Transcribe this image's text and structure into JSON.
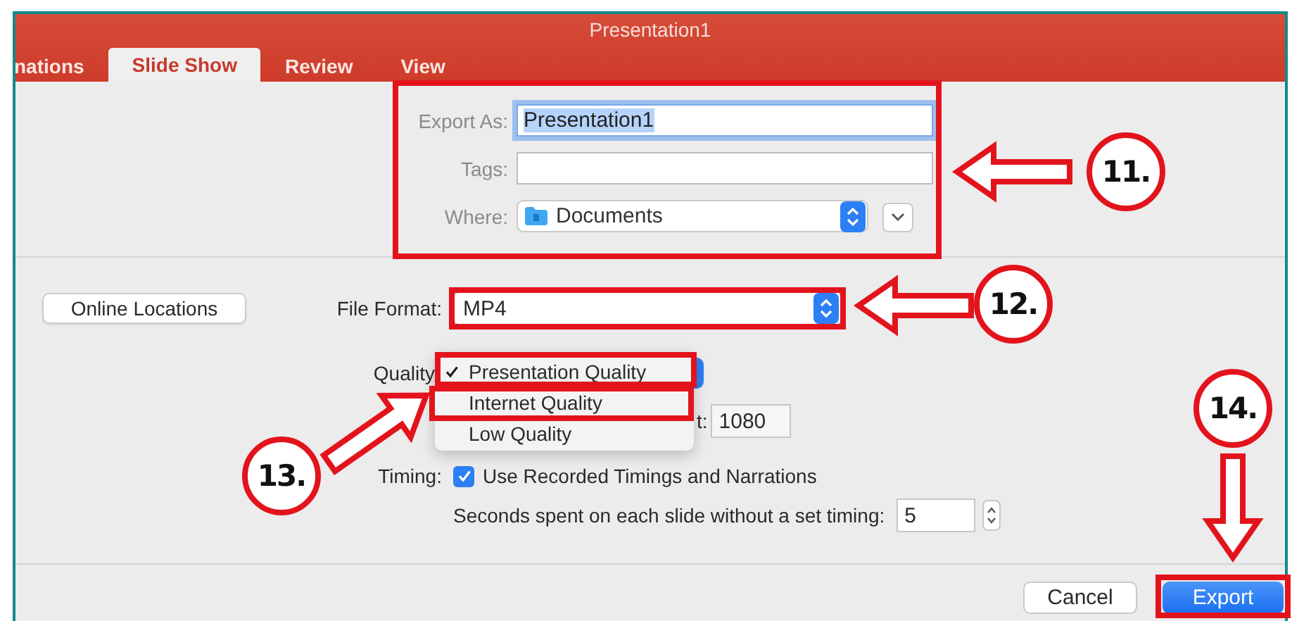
{
  "window": {
    "title": "Presentation1"
  },
  "tabs": [
    {
      "label": "nations",
      "selected": false
    },
    {
      "label": "Slide Show",
      "selected": true
    },
    {
      "label": "Review",
      "selected": false
    },
    {
      "label": "View",
      "selected": false
    }
  ],
  "save_panel": {
    "highlighted": true,
    "export_as": {
      "label": "Export As:",
      "value": "Presentation1",
      "focused": true
    },
    "tags": {
      "label": "Tags:"
    },
    "where": {
      "label": "Where:",
      "value": "Documents"
    }
  },
  "online_locations_button": "Online Locations",
  "file_format": {
    "label": "File Format:",
    "value": "MP4",
    "highlighted": true
  },
  "quality": {
    "label": "Quality",
    "menu": [
      {
        "label": "Presentation Quality",
        "checked": true,
        "highlighted": true
      },
      {
        "label": "Internet Quality",
        "checked": false,
        "highlighted": true
      },
      {
        "label": "Low Quality",
        "checked": false,
        "highlighted": false
      }
    ]
  },
  "height": {
    "label": "t:",
    "value": "1080"
  },
  "timing": {
    "label": "Timing:",
    "checkbox_label": "Use Recorded Timings and Narrations",
    "checked": true
  },
  "seconds": {
    "label": "Seconds spent on each slide without a set timing:",
    "value": "5"
  },
  "buttons": [
    {
      "label": "Cancel",
      "kind": "secondary",
      "highlighted": false
    },
    {
      "label": "Export",
      "kind": "default",
      "highlighted": true
    }
  ],
  "callouts": [
    {
      "number": "11.",
      "kind": "arrow-left"
    },
    {
      "number": "12.",
      "kind": "arrow-left"
    },
    {
      "number": "13.",
      "kind": "arrow-up-right"
    },
    {
      "number": "14.",
      "kind": "arrow-down"
    }
  ]
}
